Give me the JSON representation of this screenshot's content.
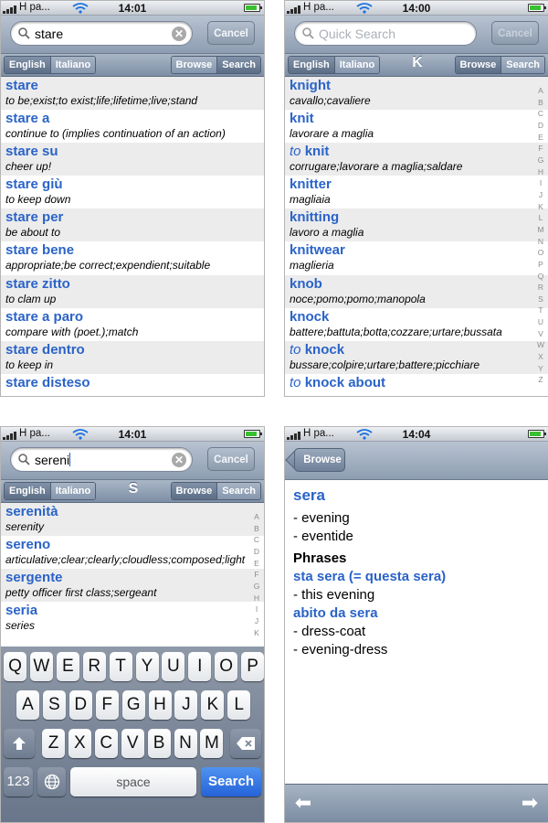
{
  "screens": [
    {
      "status": {
        "carrier": "H pa...",
        "time": "14:01"
      },
      "search": {
        "value": "stare",
        "placeholder": "",
        "cancel": "Cancel"
      },
      "toolbar": {
        "lang_left": "English",
        "lang_right": "Italiano",
        "letter": "",
        "browse": "Browse",
        "search": "Search"
      },
      "entries": [
        {
          "prefix": "",
          "term": "stare",
          "translation": "to be;exist;to exist;life;lifetime;live;stand"
        },
        {
          "prefix": "",
          "term": "stare a",
          "translation": "continue to (implies continuation of an action)"
        },
        {
          "prefix": "",
          "term": "stare su",
          "translation": "cheer up!"
        },
        {
          "prefix": "",
          "term": "stare giù",
          "translation": "to keep down"
        },
        {
          "prefix": "",
          "term": "stare per",
          "translation": "be about to"
        },
        {
          "prefix": "",
          "term": "stare bene",
          "translation": "appropriate;be correct;expendient;suitable"
        },
        {
          "prefix": "",
          "term": "stare zitto",
          "translation": "to clam up"
        },
        {
          "prefix": "",
          "term": "stare a paro",
          "translation": "compare with (poet.);match"
        },
        {
          "prefix": "",
          "term": "stare dentro",
          "translation": "to keep in"
        },
        {
          "prefix": "",
          "term": "stare disteso",
          "translation": ""
        }
      ]
    },
    {
      "status": {
        "carrier": "H pa...",
        "time": "14:00"
      },
      "search": {
        "value": "",
        "placeholder": "Quick Search",
        "cancel": "Cancel"
      },
      "toolbar": {
        "lang_left": "English",
        "lang_right": "Italiano",
        "letter": "K",
        "browse": "Browse",
        "search": "Search"
      },
      "entries": [
        {
          "prefix": "",
          "term": "knight",
          "translation": "cavallo;cavaliere"
        },
        {
          "prefix": "",
          "term": "knit",
          "translation": "lavorare a maglia"
        },
        {
          "prefix": "to",
          "term": "knit",
          "translation": "corrugare;lavorare a maglia;saldare"
        },
        {
          "prefix": "",
          "term": "knitter",
          "translation": "magliaia"
        },
        {
          "prefix": "",
          "term": "knitting",
          "translation": "lavoro a maglia"
        },
        {
          "prefix": "",
          "term": "knitwear",
          "translation": "maglieria"
        },
        {
          "prefix": "",
          "term": "knob",
          "translation": "noce;pomo;pomo;manopola"
        },
        {
          "prefix": "",
          "term": "knock",
          "translation": "battere;battuta;botta;cozzare;urtare;bussata"
        },
        {
          "prefix": "to",
          "term": "knock",
          "translation": "bussare;colpire;urtare;battere;picchiare"
        },
        {
          "prefix": "to",
          "term": "knock about",
          "translation": ""
        }
      ],
      "index": [
        "A",
        "B",
        "C",
        "D",
        "E",
        "F",
        "G",
        "H",
        "I",
        "J",
        "K",
        "L",
        "M",
        "N",
        "O",
        "P",
        "Q",
        "R",
        "S",
        "T",
        "U",
        "V",
        "W",
        "X",
        "Y",
        "Z"
      ]
    },
    {
      "status": {
        "carrier": "H pa...",
        "time": "14:01"
      },
      "search": {
        "value": "sereni",
        "placeholder": "",
        "cancel": "Cancel"
      },
      "toolbar": {
        "lang_left": "English",
        "lang_right": "Italiano",
        "letter": "S",
        "browse": "Browse",
        "search": "Search"
      },
      "entries": [
        {
          "prefix": "",
          "term": "serenità",
          "translation": "serenity"
        },
        {
          "prefix": "",
          "term": "sereno",
          "translation": "articulative;clear;clearly;cloudless;composed;light"
        },
        {
          "prefix": "",
          "term": "sergente",
          "translation": "petty officer first class;sergeant"
        },
        {
          "prefix": "",
          "term": "seria",
          "translation": "series"
        }
      ],
      "index": [
        "A",
        "B",
        "C",
        "D",
        "E",
        "F",
        "G",
        "H",
        "I",
        "J",
        "K"
      ],
      "keyboard": {
        "row1": [
          "Q",
          "W",
          "E",
          "R",
          "T",
          "Y",
          "U",
          "I",
          "O",
          "P"
        ],
        "row2": [
          "A",
          "S",
          "D",
          "F",
          "G",
          "H",
          "J",
          "K",
          "L"
        ],
        "row3": [
          "Z",
          "X",
          "C",
          "V",
          "B",
          "N",
          "M"
        ],
        "numbers": "123",
        "space": "space",
        "search": "Search"
      }
    },
    {
      "status": {
        "carrier": "H pa...",
        "time": "14:04"
      },
      "nav": {
        "back": "Browse"
      },
      "entry": {
        "term": "sera",
        "definitions": [
          "- evening",
          "- eventide"
        ],
        "phrases_title": "Phrases",
        "phrases": [
          {
            "term": "sta sera (= questa sera)",
            "definitions": [
              "- this evening"
            ]
          },
          {
            "term": "abito da sera",
            "definitions": [
              "- dress-coat",
              "- evening-dress"
            ]
          }
        ]
      }
    }
  ],
  "icons": {
    "signal": "signal-bars-icon",
    "wifi": "wifi-icon",
    "battery": "battery-icon",
    "search": "magnifier-icon",
    "clear": "clear-x-icon",
    "shift": "shift-icon",
    "delete": "delete-icon",
    "globe": "globe-icon",
    "prev": "left-arrow-icon",
    "next": "right-arrow-icon"
  }
}
